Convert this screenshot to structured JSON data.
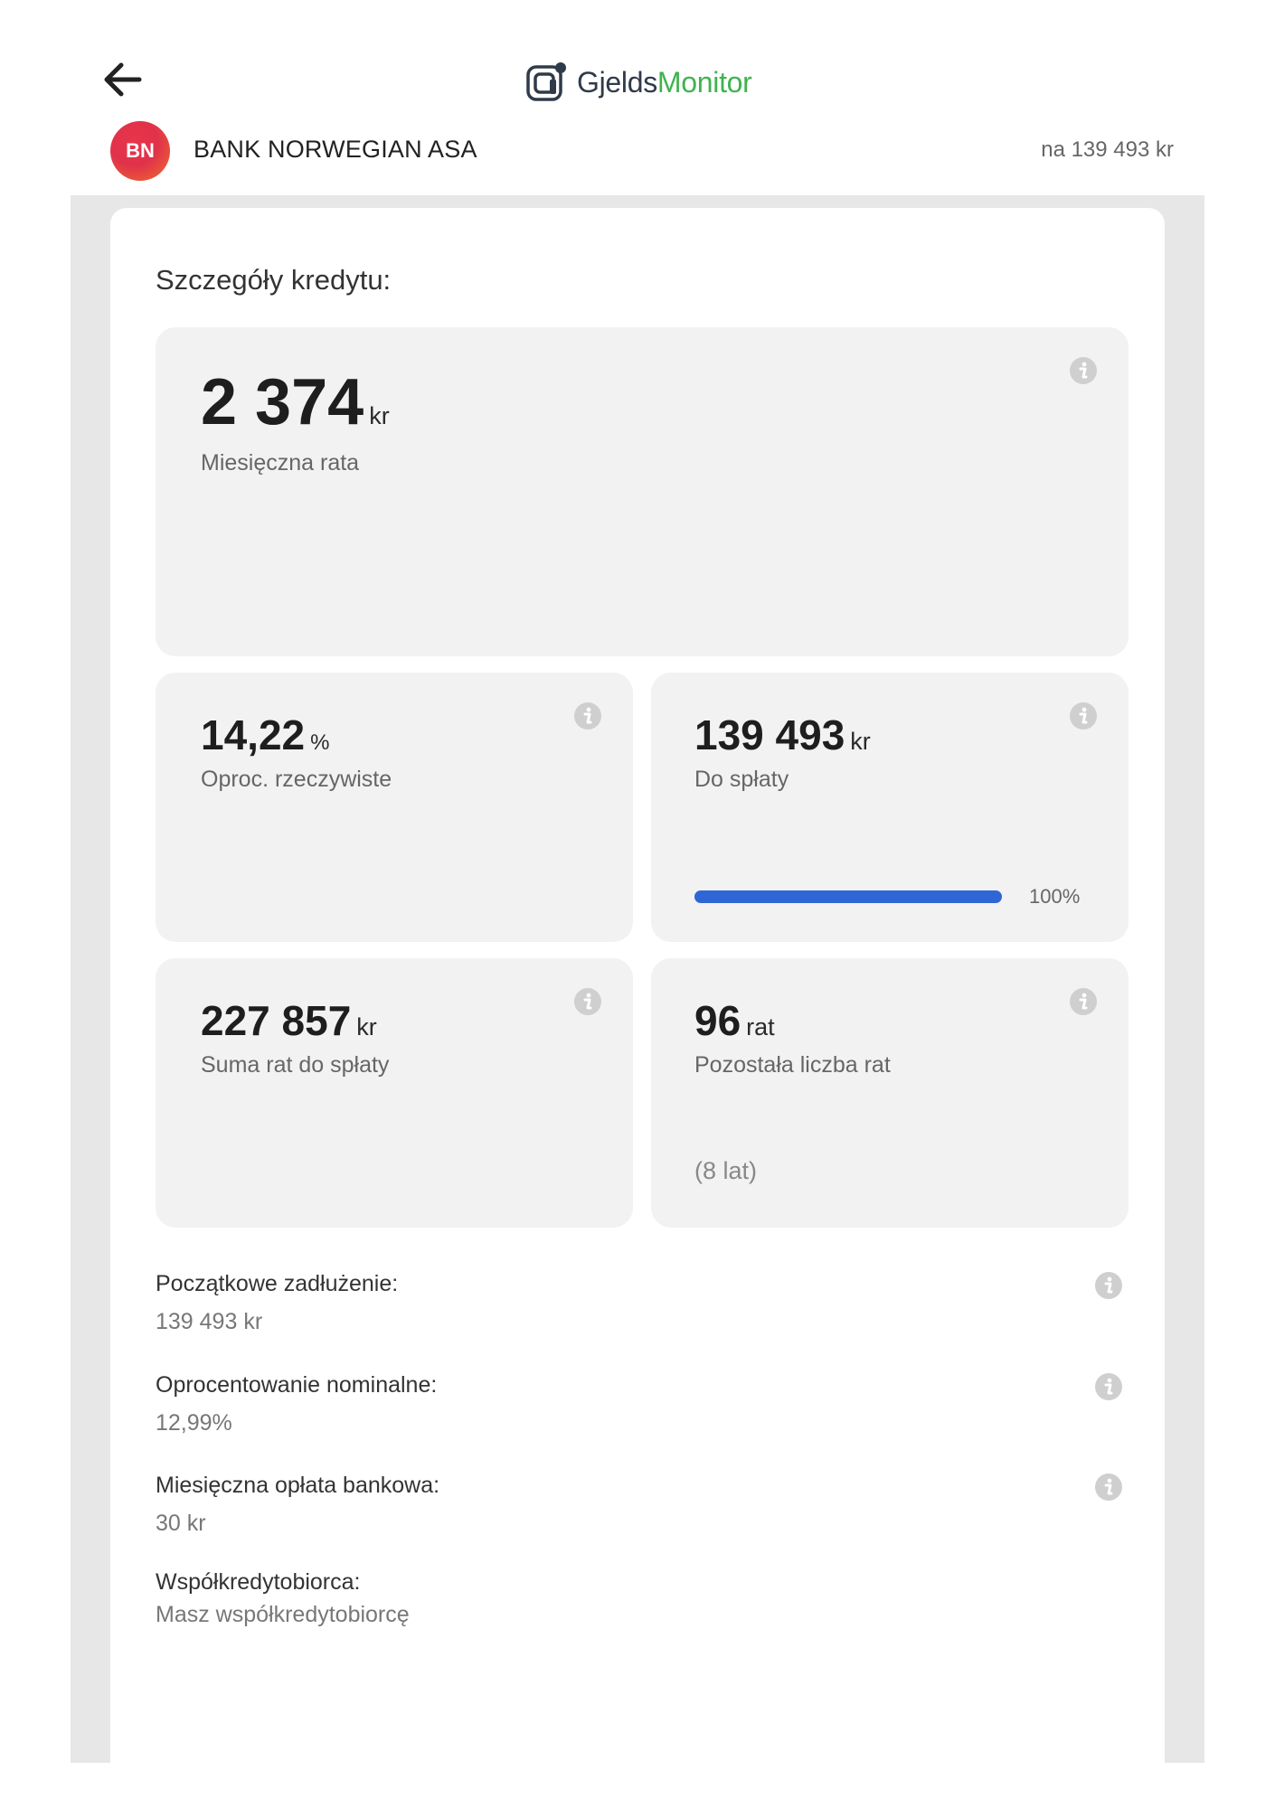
{
  "app": {
    "logo_part1": "Gjelds",
    "logo_part2": "Monitor",
    "brand_color": "#3fb34f"
  },
  "bank": {
    "initials": "BN",
    "name": "BANK NORWEGIAN ASA",
    "amount": "na 139 493 kr"
  },
  "panel": {
    "title": "Szczegóły kredytu:"
  },
  "tiles": {
    "monthly": {
      "value": "2 374",
      "unit": "kr",
      "label": "Miesięczna rata"
    },
    "rate": {
      "value": "14,22",
      "unit": "%",
      "label": "Oproc. rzeczywiste"
    },
    "remaining": {
      "value": "139 493",
      "unit": "kr",
      "label": "Do spłaty",
      "progress": 100,
      "progress_label": "100%",
      "progress_color": "#2f66d6"
    },
    "total": {
      "value": "227 857",
      "unit": "kr",
      "label": "Suma rat do spłaty"
    },
    "installments": {
      "value": "96",
      "unit": "rat",
      "label": "Pozostała liczba rat",
      "note": "(8 lat)"
    }
  },
  "details": [
    {
      "label": "Początkowe zadłużenie:",
      "value": "139 493 kr"
    },
    {
      "label": "Oprocentowanie nominalne:",
      "value": "12,99%"
    },
    {
      "label": "Miesięczna opłata bankowa:",
      "value": "30 kr"
    },
    {
      "label": "Współkredytobiorca:",
      "value": "Masz współkredytobiorcę"
    }
  ],
  "icons": {
    "back": "arrow-left-icon",
    "info": "info-icon",
    "logo": "gjeldsmonitor-logo-icon"
  }
}
